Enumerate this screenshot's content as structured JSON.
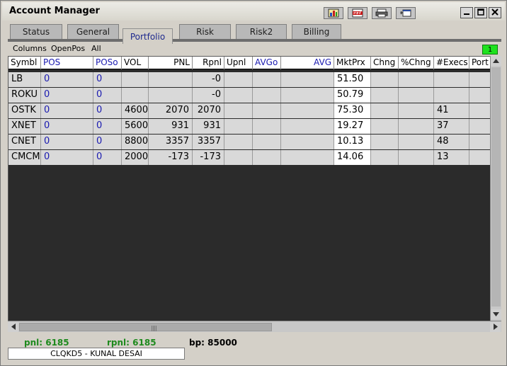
{
  "window": {
    "title": "Account Manager"
  },
  "toolbar_icons": [
    "chart-icon",
    "pdf-icon",
    "print-icon",
    "window-icon"
  ],
  "window_controls": {
    "minimize": "_",
    "maximize": "□",
    "close": "✕"
  },
  "tabs": [
    {
      "label": "Status"
    },
    {
      "label": "General"
    },
    {
      "label": "Portfolio",
      "active": true
    },
    {
      "label": "Risk"
    },
    {
      "label": "Risk2"
    },
    {
      "label": "Billing"
    }
  ],
  "menu": {
    "columns": "Columns",
    "openpos": "OpenPos",
    "all": "All"
  },
  "badge_count": "1",
  "colors": {
    "blue_text": "#1a1ab0",
    "green_text": "#1e8a1e",
    "badge": "#1ee21e"
  },
  "table": {
    "headers": [
      "Symbl",
      "POS",
      "POSo",
      "VOL",
      "PNL",
      "Rpnl",
      "Upnl",
      "AVGo",
      "AVG",
      "MktPrx",
      "Chng",
      "%Chng",
      "#Execs",
      "Port"
    ],
    "rows": [
      {
        "symbol": "LB",
        "pos": "0",
        "poso": "0",
        "vol": "",
        "pnl": "",
        "rpnl": "-0",
        "upnl": "",
        "avgo": "",
        "avg": "",
        "mktprx": "51.50",
        "chng": "",
        "pchng": "",
        "execs": "",
        "port": ""
      },
      {
        "symbol": "ROKU",
        "pos": "0",
        "poso": "0",
        "vol": "",
        "pnl": "",
        "rpnl": "-0",
        "upnl": "",
        "avgo": "",
        "avg": "",
        "mktprx": "50.79",
        "chng": "",
        "pchng": "",
        "execs": "",
        "port": ""
      },
      {
        "symbol": "OSTK",
        "pos": "0",
        "poso": "0",
        "vol": "4600",
        "pnl": "2070",
        "rpnl": "2070",
        "upnl": "",
        "avgo": "",
        "avg": "",
        "mktprx": "75.30",
        "chng": "",
        "pchng": "",
        "execs": "41",
        "port": ""
      },
      {
        "symbol": "XNET",
        "pos": "0",
        "poso": "0",
        "vol": "5600",
        "pnl": "931",
        "rpnl": "931",
        "upnl": "",
        "avgo": "",
        "avg": "",
        "mktprx": "19.27",
        "chng": "",
        "pchng": "",
        "execs": "37",
        "port": ""
      },
      {
        "symbol": "CNET",
        "pos": "0",
        "poso": "0",
        "vol": "8800",
        "pnl": "3357",
        "rpnl": "3357",
        "upnl": "",
        "avgo": "",
        "avg": "",
        "mktprx": "10.13",
        "chng": "",
        "pchng": "",
        "execs": "48",
        "port": ""
      },
      {
        "symbol": "CMCM",
        "pos": "0",
        "poso": "0",
        "vol": "2000",
        "pnl": "-173",
        "rpnl": "-173",
        "upnl": "",
        "avgo": "",
        "avg": "",
        "mktprx": "14.06",
        "chng": "",
        "pchng": "",
        "execs": "13",
        "port": ""
      }
    ]
  },
  "footer": {
    "pnl": "pnl: 6185",
    "rpnl": "rpnl: 6185",
    "bp": "bp: 85000",
    "user": "CLQKD5 - KUNAL DESAI"
  }
}
